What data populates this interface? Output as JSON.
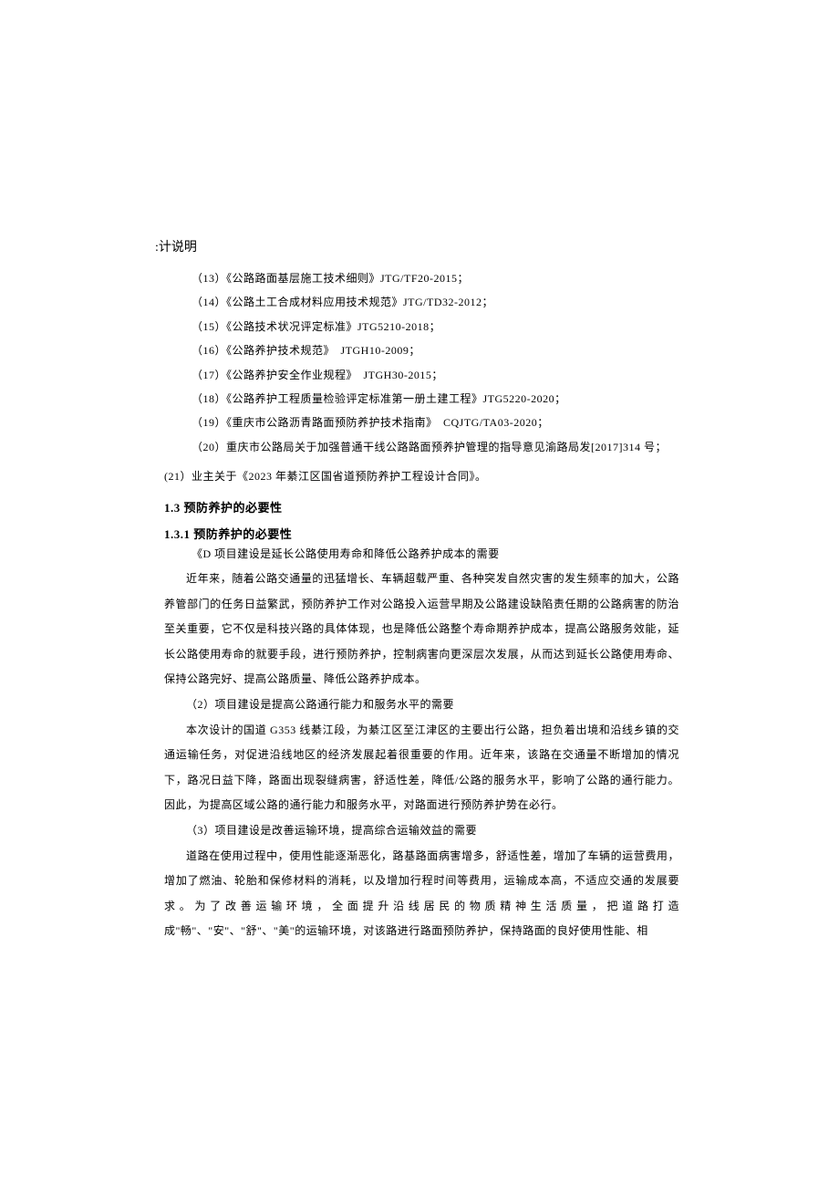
{
  "partial_header": ":计说明",
  "references": [
    "（13）《公路路面基层施工技术细则》JTG/TF20-2015；",
    "（14）《公路土工合成材料应用技术规范》JTG/TD32-2012；",
    "（15）《公路技术状况评定标准》JTG5210-2018；",
    "（16）《公路养护技术规范》　JTGH10-2009；",
    "（17）《公路养护安全作业规程》　JTGH30-2015；",
    "（18）《公路养护工程质量检验评定标准第一册土建工程》JTG5220-2020；",
    "（19）《重庆市公路沥青路面预防养护技术指南》　CQJTG/TA03-2020；",
    "（20）重庆市公路局关于加强普通干线公路路面预养护管理的指导意见渝路局发[2017]314 号；"
  ],
  "ref_21": "(21）业主关于《2023 年綦江区国省道预防养护工程设计合同》。",
  "h13": "1.3 预防养护的必要性",
  "h131": "1.3.1 预防养护的必要性",
  "d_line": "《D 项目建设是延长公路使用寿命和降低公路养护成本的需要",
  "para1": "近年来，随着公路交通量的迅猛增长、车辆超载严重、各种突发自然灾害的发生频率的加大，公路养管部门的任务日益繁武，预防养护工作对公路投入运营早期及公路建设缺陷责任期的公路病害的防治至关重要，它不仅是科技兴路的具体体现，也是降低公路整个寿命期养护成本，提高公路服务效能，延长公路使用寿命的就要手段，进行预防养护，控制病害向更深层次发展，从而达到延长公路使用寿命、保持公路完好、提高公路质量、降低公路养护成本。",
  "sub2": "（2）项目建设是提高公路通行能力和服务水平的需要",
  "para2": "本次设计的国道 G353 线綦江段，为綦江区至江津区的主要出行公路，担负着出境和沿线乡镇的交通运输任务，对促进沿线地区的经济发展起着很重要的作用。近年来，该路在交通量不断增加的情况下，路况日益下降，路面出现裂缝病害，舒适性差，降低/公路的服务水平，影响了公路的通行能力。因此，为提高区域公路的通行能力和服务水平，对路面进行预防养护势在必行。",
  "sub3": "（3）项目建设是改善运输环境，提高综合运输效益的需要",
  "para3": "道路在使用过程中，使用性能逐渐恶化，路基路面病害增多，舒适性差，增加了车辆的运营费用，增加了燃油、轮胎和保修材料的消耗，以及增加行程时间等费用，运输成本高，不适应交通的发展要求。为了改善运输环境，全面提升沿线居民的物质精神生活质量，把道路打造成\"畅\"、\"安\"、\"舒\"、\"美\"的运输环境，对该路进行路面预防养护，保持路面的良好使用性能、相"
}
